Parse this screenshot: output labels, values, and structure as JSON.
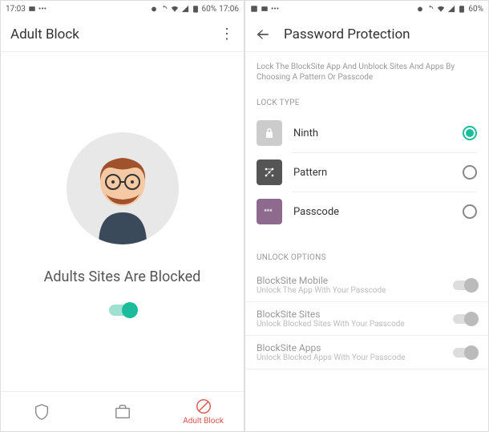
{
  "leftPhone": {
    "status": {
      "time": "17:03",
      "battery": "60%",
      "time2": "17:06"
    },
    "header": {
      "title": "Adult Block"
    },
    "main": {
      "blockedText": "Adults Sites Are Blocked"
    },
    "nav": {
      "item2Label": "Adult Block"
    }
  },
  "rightPhone": {
    "status": {
      "battery": "60%"
    },
    "header": {
      "title": "Password Protection"
    },
    "description": "Lock The BlockSite App And Unblock Sites And Apps By Choosing A Pattern Or Passcode",
    "sections": {
      "lockType": "LOCK TYPE",
      "unlockOptions": "UNLOCK OPTIONS"
    },
    "lockTypes": [
      {
        "label": "Ninth"
      },
      {
        "label": "Pattern"
      },
      {
        "label": "Passcode"
      }
    ],
    "unlockOptions": [
      {
        "title": "BlockSite Mobile",
        "sub": "Unlock The App With Your Passcode"
      },
      {
        "title": "BlockSite Sites",
        "sub": "Unlock Blocked Sites With Your Passcode"
      },
      {
        "title": "BlockSite Apps",
        "sub": "Unlock Blocked Apps With Your Passcode"
      }
    ]
  }
}
